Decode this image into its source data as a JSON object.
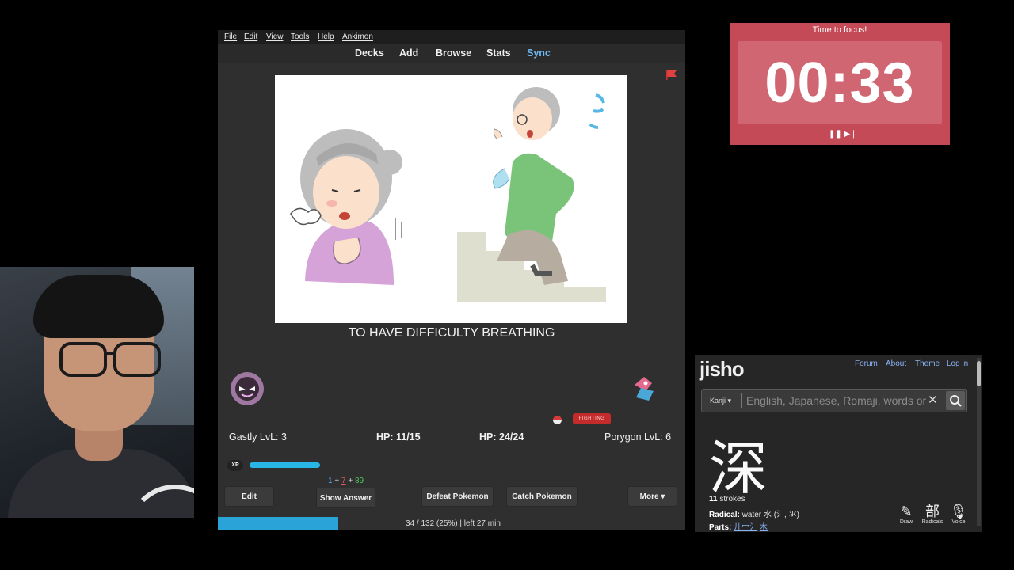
{
  "anki": {
    "menu": [
      "File",
      "Edit",
      "View",
      "Tools",
      "Help",
      "Ankimon"
    ],
    "toolbar": {
      "decks": "Decks",
      "add": "Add",
      "browse": "Browse",
      "stats": "Stats",
      "sync": "Sync"
    },
    "card": {
      "text": "TO HAVE DIFFICULTY BREATHING"
    },
    "battle": {
      "type_badge": "FIGHTING",
      "player_name_level": "Gastly LvL: 3",
      "player_hp": "HP: 11/15",
      "enemy_hp": "HP: 24/24",
      "enemy_name_level": "Porygon LvL: 6",
      "xp_label": "XP",
      "xp_fill": 0.3
    },
    "counts": {
      "new": "1",
      "plus1": "+",
      "learn": "7",
      "plus2": "+",
      "review": "89"
    },
    "buttons": {
      "edit": "Edit",
      "show_answer": "Show Answer",
      "defeat": "Defeat Pokemon",
      "catch": "Catch Pokemon",
      "more": "More ▾"
    },
    "progress": {
      "text": "34 / 132 (25%) | left 27 min",
      "fraction": 0.258
    }
  },
  "timer": {
    "title": "Time to focus!",
    "time": "00:33",
    "controls": "❚❚ ▶❘"
  },
  "jisho": {
    "logo": "jisho",
    "nav": {
      "forum": "Forum",
      "about": "About",
      "theme": "Theme",
      "login": "Log in"
    },
    "search": {
      "mode": "Kanji ▾",
      "placeholder": "English, Japanese, Romaji, words or text"
    },
    "kanji": "深",
    "strokes_count": "11",
    "strokes_word": "strokes",
    "radical_label": "Radical:",
    "radical_value": "water 水 (氵, 氺)",
    "parts_label": "Parts:",
    "parts": [
      "儿",
      "冖",
      "氵",
      "木"
    ],
    "tools": {
      "draw": "Draw",
      "radicals": "Radicals",
      "voice": "Voice"
    },
    "tool_icons": {
      "draw": "pencil-icon",
      "radicals": "radical-icon",
      "voice": "microphone-icon"
    }
  },
  "colors": {
    "anki_bg": "#2f2f2f",
    "sync_link": "#6eb7f0",
    "xp_bar": "#27b6e5",
    "progress": "#2aa3d8",
    "timer_bg": "#c54a58",
    "jisho_bg": "#262626",
    "jisho_link": "#8ab4f8"
  }
}
